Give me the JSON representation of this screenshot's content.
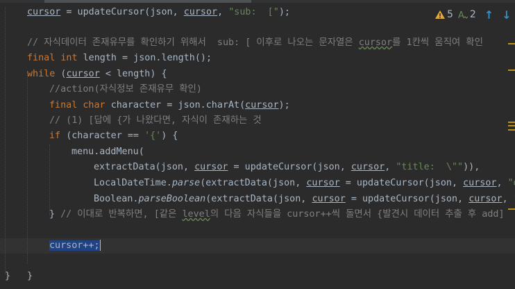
{
  "editor": {
    "lines": [
      {
        "parts": [
          {
            "t": "cursor",
            "c": "ul"
          },
          {
            "t": " = updateCursor(json, "
          },
          {
            "t": "cursor",
            "c": "ul"
          },
          {
            "t": ", "
          },
          {
            "t": "\"sub:  [\"",
            "c": "str"
          },
          {
            "t": ");"
          }
        ]
      },
      {
        "parts": []
      },
      {
        "parts": [
          {
            "t": "// 자식데이터 존재유무를 확인하기 위해서  sub: [ 이후로 나오는 문자열은 ",
            "c": "cm"
          },
          {
            "t": "cursor",
            "c": "cm wavy"
          },
          {
            "t": "를 1칸씩 움직여 확인",
            "c": "cm"
          }
        ]
      },
      {
        "parts": [
          {
            "t": "final ",
            "c": "kw"
          },
          {
            "t": "int ",
            "c": "kw"
          },
          {
            "t": "length = json.length();"
          }
        ]
      },
      {
        "parts": [
          {
            "t": "while ",
            "c": "kw"
          },
          {
            "t": "("
          },
          {
            "t": "cursor",
            "c": "ul"
          },
          {
            "t": " < length) {"
          }
        ]
      },
      {
        "parts": [
          {
            "t": "//action(자식정보 존재유무 확인)",
            "c": "cm"
          }
        ]
      },
      {
        "parts": [
          {
            "t": "final ",
            "c": "kw"
          },
          {
            "t": "char ",
            "c": "kw"
          },
          {
            "t": "character = json.charAt("
          },
          {
            "t": "cursor",
            "c": "ul"
          },
          {
            "t": ");"
          }
        ]
      },
      {
        "parts": [
          {
            "t": "// (1) [답에 {가 나왔다면, 자식이 존재하는 것",
            "c": "cm"
          }
        ]
      },
      {
        "parts": [
          {
            "t": "if ",
            "c": "kw"
          },
          {
            "t": "(character == "
          },
          {
            "t": "'{'",
            "c": "str"
          },
          {
            "t": ") {"
          }
        ]
      },
      {
        "parts": [
          {
            "t": "menu.addMenu("
          }
        ]
      },
      {
        "parts": [
          {
            "t": "extractData(json, "
          },
          {
            "t": "cursor",
            "c": "ul"
          },
          {
            "t": " = updateCursor(json, "
          },
          {
            "t": "cursor",
            "c": "ul"
          },
          {
            "t": ", "
          },
          {
            "t": "\"title:  \\\"\"",
            "c": "str"
          },
          {
            "t": ")),"
          }
        ]
      },
      {
        "parts": [
          {
            "t": "LocalDateTime."
          },
          {
            "t": "parse",
            "c": "it"
          },
          {
            "t": "(extractData(json, "
          },
          {
            "t": "cursor",
            "c": "ul"
          },
          {
            "t": " = updateCursor(json, "
          },
          {
            "t": "cursor",
            "c": "ul"
          },
          {
            "t": ", "
          },
          {
            "t": "\"d",
            "c": "str"
          }
        ]
      },
      {
        "parts": [
          {
            "t": "Boolean."
          },
          {
            "t": "parseBoolean",
            "c": "it"
          },
          {
            "t": "(extractData(json, "
          },
          {
            "t": "cursor",
            "c": "ul"
          },
          {
            "t": " = updateCursor(json, "
          },
          {
            "t": "cursor",
            "c": "ul"
          },
          {
            "t": ", "
          },
          {
            "t": "\"",
            "c": "str"
          }
        ]
      },
      {
        "parts": [
          {
            "t": "} "
          },
          {
            "t": "// 이대로 반복하면, [같은 ",
            "c": "cm"
          },
          {
            "t": "level",
            "c": "cm wavy"
          },
          {
            "t": "의 다음 자식들을 cursor++씩 돌면서 {발견시 데이터 추출 후 add]",
            "c": "cm"
          }
        ]
      },
      {
        "parts": []
      },
      {
        "parts": [
          {
            "t": "cursor",
            "c": "sel"
          },
          {
            "t": "++;",
            "c": "sel"
          }
        ]
      },
      {
        "parts": []
      },
      {
        "parts": [
          {
            "t": "}"
          }
        ]
      },
      {
        "parts": [
          {
            "t": "}"
          }
        ]
      }
    ]
  },
  "status": {
    "warnings": "5",
    "weak_warnings": "2",
    "warn_icon": "warning-triangle-icon",
    "weak_icon": "weak-warning-icon",
    "prev_icon": "arrow-up-icon",
    "next_icon": "arrow-down-icon"
  }
}
